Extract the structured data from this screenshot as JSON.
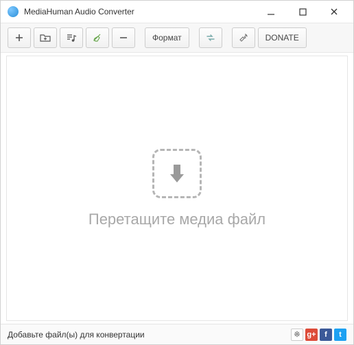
{
  "titlebar": {
    "title": "MediaHuman Audio Converter"
  },
  "toolbar": {
    "format_label": "Формат",
    "donate_label": "DONATE"
  },
  "content": {
    "drop_hint": "Перетащите медиа файл"
  },
  "statusbar": {
    "message": "Добавьте файл(ы) для конвертации"
  },
  "social": {
    "vk": "※",
    "gp": "g+",
    "fb": "f",
    "tw": "t"
  }
}
